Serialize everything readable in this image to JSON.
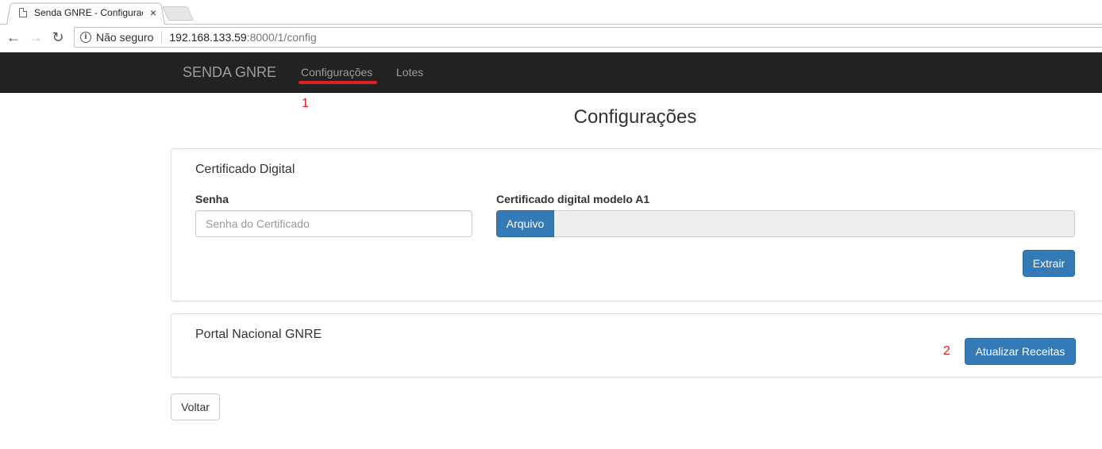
{
  "browser": {
    "tab_title": "Senda GNRE - Configurações",
    "tab_close": "×",
    "security_label": "Não seguro",
    "url_host": "192.168.133.59",
    "url_rest": ":8000/1/config"
  },
  "navbar": {
    "brand": "SENDA GNRE",
    "links": [
      "Configurações",
      "Lotes"
    ],
    "active_link": "Configurações"
  },
  "annotations": {
    "marker_1": "1",
    "marker_2": "2",
    "color": "#e02020"
  },
  "page": {
    "title": "Configurações"
  },
  "certificado_panel": {
    "title": "Certificado Digital",
    "senha_label": "Senha",
    "senha_placeholder": "Senha do Certificado",
    "senha_value": "",
    "arquivo_label": "Certificado digital modelo A1",
    "arquivo_button": "Arquivo",
    "extrair_button": "Extrair"
  },
  "portal_panel": {
    "title": "Portal Nacional GNRE",
    "atualizar_button": "Atualizar Receitas"
  },
  "footer": {
    "voltar_button": "Voltar"
  },
  "colors": {
    "primary": "#337ab7",
    "navbar_bg": "#222222",
    "navbar_text": "#9d9d9d"
  }
}
